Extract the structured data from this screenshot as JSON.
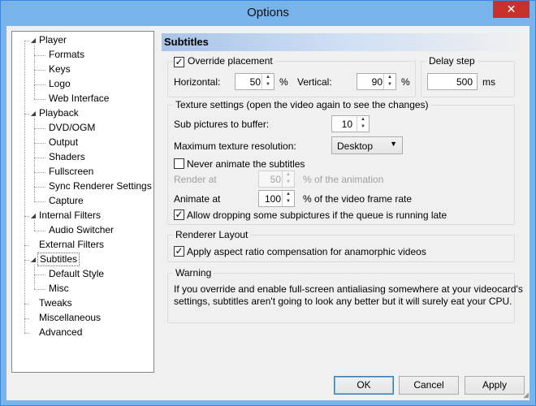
{
  "window": {
    "title": "Options",
    "close_glyph": "✕"
  },
  "tree": {
    "items": [
      {
        "label": "Player",
        "level": 0,
        "expanded": true
      },
      {
        "label": "Formats",
        "level": 1
      },
      {
        "label": "Keys",
        "level": 1
      },
      {
        "label": "Logo",
        "level": 1
      },
      {
        "label": "Web Interface",
        "level": 1
      },
      {
        "label": "Playback",
        "level": 0,
        "expanded": true
      },
      {
        "label": "DVD/OGM",
        "level": 1
      },
      {
        "label": "Output",
        "level": 1
      },
      {
        "label": "Shaders",
        "level": 1
      },
      {
        "label": "Fullscreen",
        "level": 1
      },
      {
        "label": "Sync Renderer Settings",
        "level": 1
      },
      {
        "label": "Capture",
        "level": 1
      },
      {
        "label": "Internal Filters",
        "level": 0,
        "expanded": true
      },
      {
        "label": "Audio Switcher",
        "level": 1
      },
      {
        "label": "External Filters",
        "level": 0
      },
      {
        "label": "Subtitles",
        "level": 0,
        "expanded": true,
        "selected": true
      },
      {
        "label": "Default Style",
        "level": 1
      },
      {
        "label": "Misc",
        "level": 1
      },
      {
        "label": "Tweaks",
        "level": 0
      },
      {
        "label": "Miscellaneous",
        "level": 0
      },
      {
        "label": "Advanced",
        "level": 0
      }
    ]
  },
  "page": {
    "title": "Subtitles"
  },
  "placement": {
    "override_label": "Override placement",
    "override_checked": true,
    "horizontal_label": "Horizontal:",
    "horizontal_value": "50",
    "horizontal_unit": "%",
    "vertical_label": "Vertical:",
    "vertical_value": "90",
    "vertical_unit": "%"
  },
  "delay": {
    "group_label": "Delay step",
    "value": "500",
    "unit": "ms"
  },
  "texture": {
    "group_label": "Texture settings (open the video again to see the changes)",
    "buffer_label": "Sub pictures to buffer:",
    "buffer_value": "10",
    "max_res_label": "Maximum texture resolution:",
    "max_res_value": "Desktop",
    "never_animate_label": "Never animate the subtitles",
    "never_animate_checked": false,
    "render_at_label": "Render at",
    "render_at_value": "50",
    "render_at_unit": "% of the animation",
    "animate_at_label": "Animate at",
    "animate_at_value": "100",
    "animate_at_unit": "% of the video frame rate",
    "allow_drop_label": "Allow dropping some subpictures if the queue is running late",
    "allow_drop_checked": true
  },
  "renderer": {
    "group_label": "Renderer Layout",
    "aspect_label": "Apply aspect ratio compensation for anamorphic videos",
    "aspect_checked": true
  },
  "warning": {
    "group_label": "Warning",
    "line1": "If you override and enable full-screen antialiasing somewhere at your videocard's",
    "line2": "settings, subtitles aren't going to look any better but it will surely eat your CPU."
  },
  "buttons": {
    "ok": "OK",
    "cancel": "Cancel",
    "apply": "Apply"
  },
  "glyphs": {
    "check": "✓",
    "up": "▲",
    "down": "▼",
    "combo": "⌄",
    "expand": "◢"
  },
  "colors": {
    "titlebar": "#78b3ea",
    "close": "#c7302b",
    "client": "#f0f0f0"
  }
}
